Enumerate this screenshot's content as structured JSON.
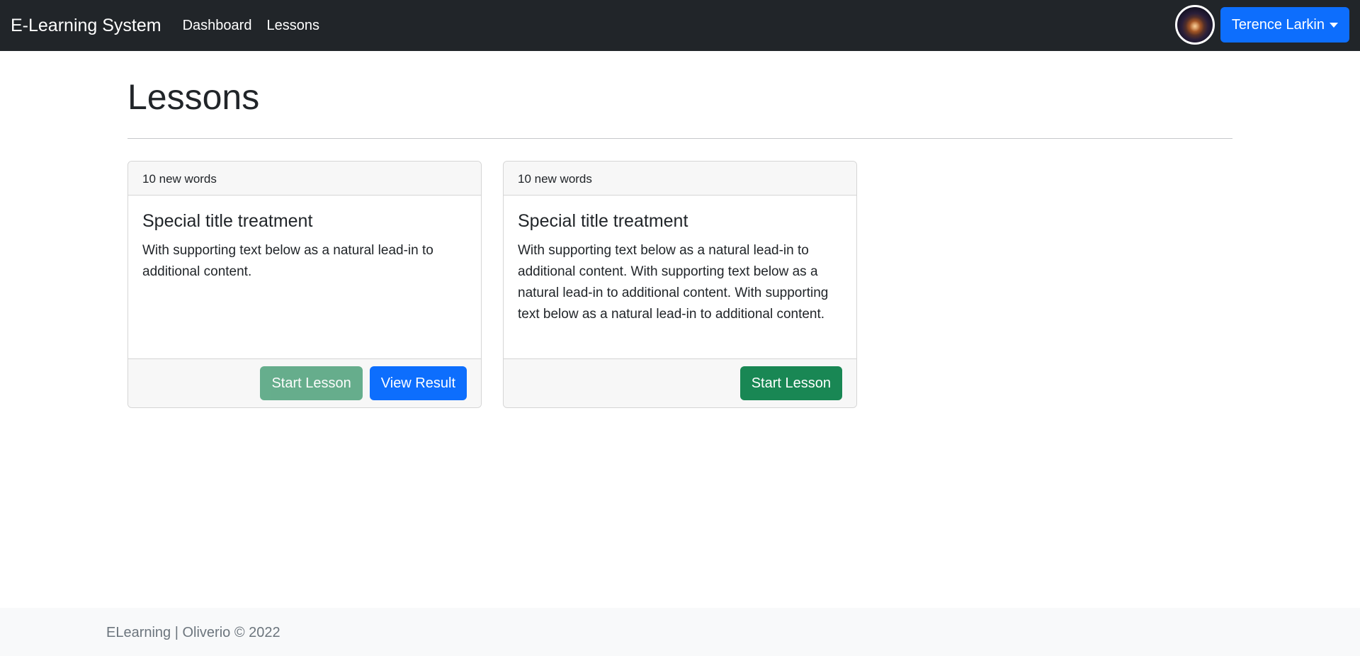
{
  "navbar": {
    "brand": "E-Learning System",
    "links": [
      "Dashboard",
      "Lessons"
    ],
    "user_name": "Terence Larkin",
    "accent": "#0d6efd",
    "background": "#212529"
  },
  "page": {
    "title": "Lessons"
  },
  "cards": [
    {
      "header": "10 new words",
      "title": "Special title treatment",
      "text": "With supporting text below as a natural lead-in to additional content.",
      "start_label": "Start Lesson",
      "start_disabled": true,
      "result_label": "View Result"
    },
    {
      "header": "10 new words",
      "title": "Special title treatment",
      "text": "With supporting text below as a natural lead-in to additional content. With supporting text below as a natural lead-in to additional content. With supporting text below as a natural lead-in to additional content.",
      "start_label": "Start Lesson",
      "start_disabled": false
    }
  ],
  "footer": {
    "text": "ELearning | Oliverio © 2022"
  },
  "colors": {
    "success": "#198754",
    "primary": "#0d6efd"
  }
}
